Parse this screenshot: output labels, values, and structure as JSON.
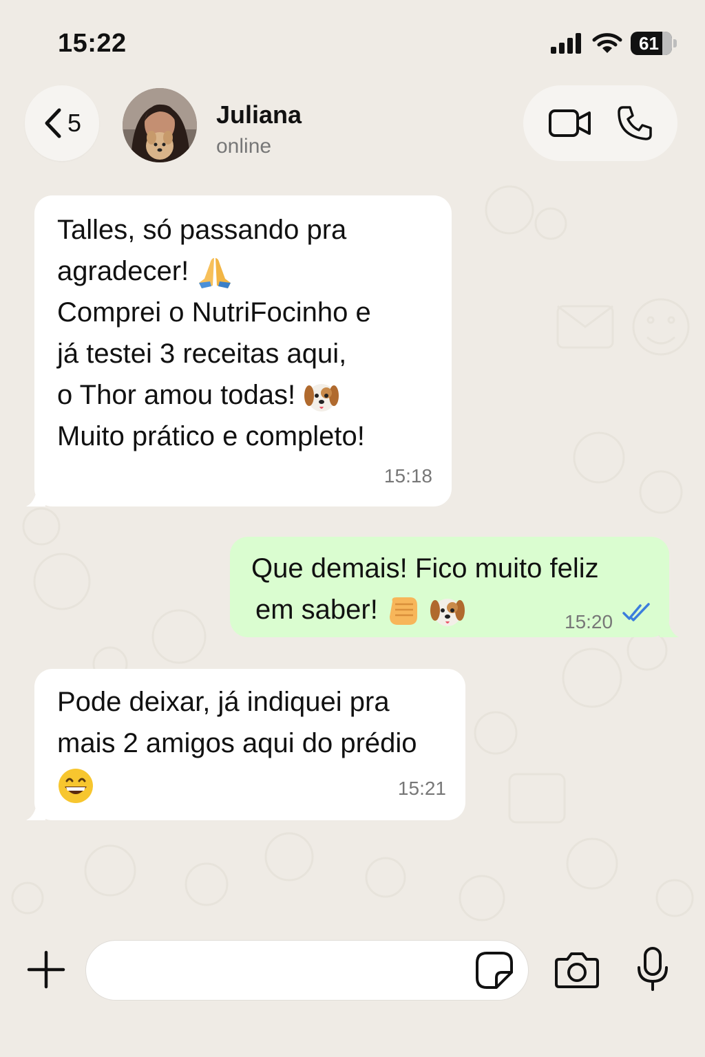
{
  "status_bar": {
    "time": "15:22",
    "battery": "61"
  },
  "header": {
    "back_count": "5",
    "contact_name": "Juliana",
    "contact_status": "online"
  },
  "messages": [
    {
      "direction": "incoming",
      "lines": [
        "Talles, só passando pra",
        "agradecer!",
        "Comprei o NutriFocinho e",
        "já testei 3 receitas aqui,",
        "o Thor amou todas!",
        "Muito prático e completo!"
      ],
      "time": "15:18"
    },
    {
      "direction": "outgoing",
      "lines": [
        "Que demais! Fico muito feliz",
        "em saber!"
      ],
      "time": "15:20",
      "status": "read"
    },
    {
      "direction": "incoming",
      "lines": [
        "Pode deixar, já indiquei pra",
        "mais 2 amigos aqui do prédio"
      ],
      "time": "15:21"
    }
  ],
  "input_bar": {
    "placeholder": ""
  },
  "colors": {
    "background": "#efebe5",
    "incoming_bubble": "#ffffff",
    "outgoing_bubble": "#dafdd0",
    "read_ticks": "#3b7ddd"
  }
}
